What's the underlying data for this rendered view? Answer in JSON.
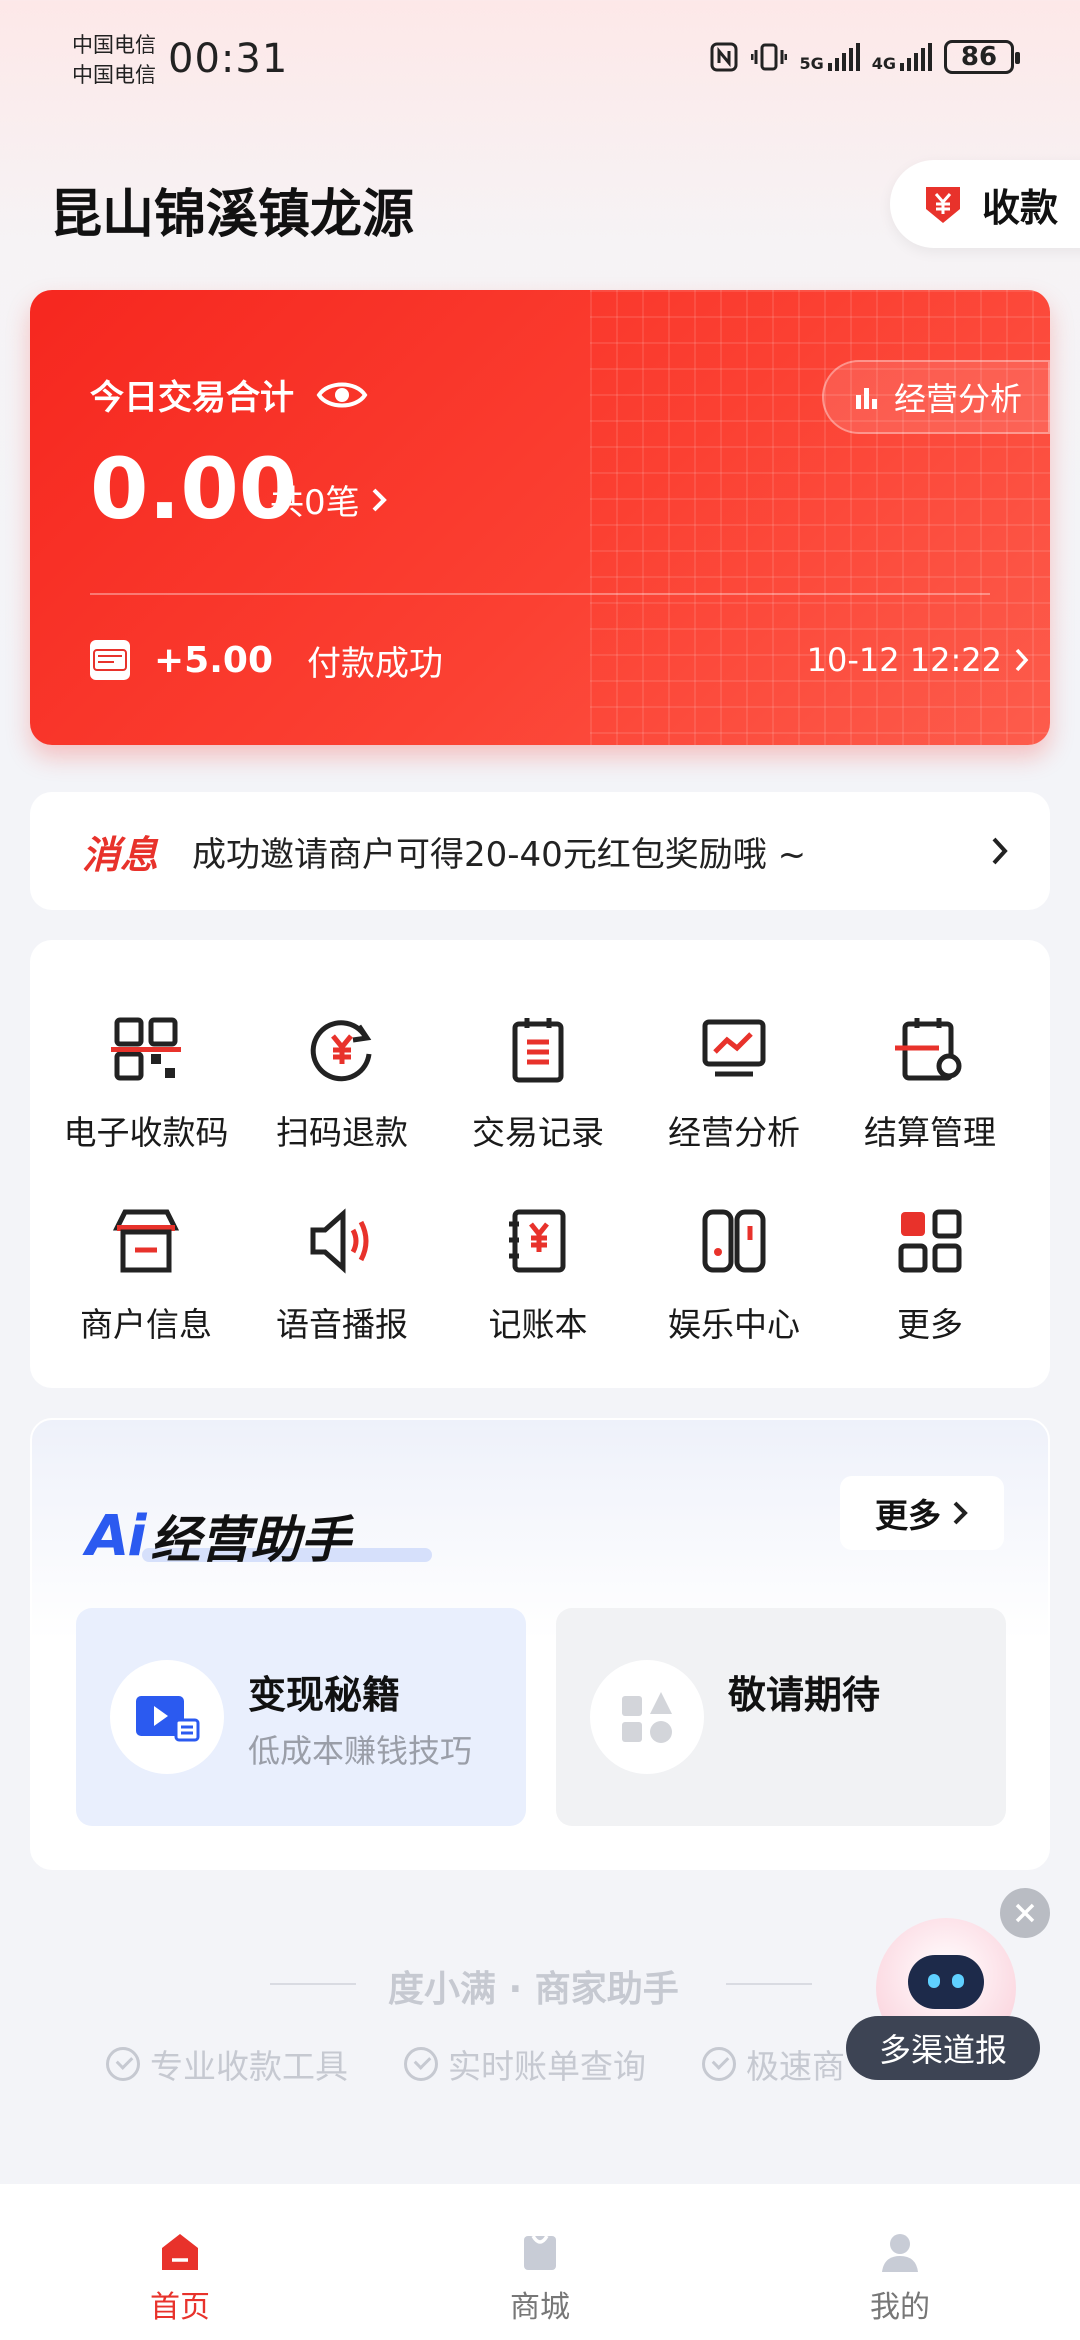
{
  "status_bar": {
    "carrier_1": "中国电信",
    "carrier_2": "中国电信",
    "time": "00:31",
    "net_5g": "5G",
    "net_4g": "4G",
    "battery": "86"
  },
  "header": {
    "shop_name": "昆山锦溪镇龙源",
    "collect_label": "收款"
  },
  "summary_card": {
    "label": "今日交易合计",
    "analysis_label": "经营分析",
    "amount": "0.00",
    "count_text": "共0笔",
    "latest": {
      "amount": "+5.00",
      "status": "付款成功",
      "time": "10-12 12:22"
    }
  },
  "message": {
    "tag": "消息",
    "text": "成功邀请商户可得20-40元红包奖励哦 ~"
  },
  "functions": [
    {
      "label": "电子收款码",
      "icon": "qr-code-icon"
    },
    {
      "label": "扫码退款",
      "icon": "refund-icon"
    },
    {
      "label": "交易记录",
      "icon": "records-icon"
    },
    {
      "label": "经营分析",
      "icon": "monitor-chart-icon"
    },
    {
      "label": "结算管理",
      "icon": "settlement-icon"
    },
    {
      "label": "商户信息",
      "icon": "store-icon"
    },
    {
      "label": "语音播报",
      "icon": "speaker-icon"
    },
    {
      "label": "记账本",
      "icon": "ledger-icon"
    },
    {
      "label": "娱乐中心",
      "icon": "game-console-icon"
    },
    {
      "label": "更多",
      "icon": "grid-more-icon"
    }
  ],
  "ai_section": {
    "title_mark": "Ai",
    "title_text": "经营助手",
    "more_label": "更多",
    "cards": [
      {
        "title": "变现秘籍",
        "subtitle": "低成本赚钱技巧"
      },
      {
        "title": "敬请期待",
        "subtitle": ""
      }
    ]
  },
  "footer": {
    "brand": "度小满 · 商家助手",
    "tags": [
      "专业收款工具",
      "实时账单查询",
      "极速商"
    ]
  },
  "floating_assistant": {
    "label": "多渠道报"
  },
  "bottom_nav": [
    {
      "label": "首页",
      "active": true
    },
    {
      "label": "商城",
      "active": false
    },
    {
      "label": "我的",
      "active": false
    }
  ],
  "colors": {
    "brand_red": "#e8322b",
    "card_red": "#f6271f",
    "ai_blue": "#2b5af0"
  }
}
